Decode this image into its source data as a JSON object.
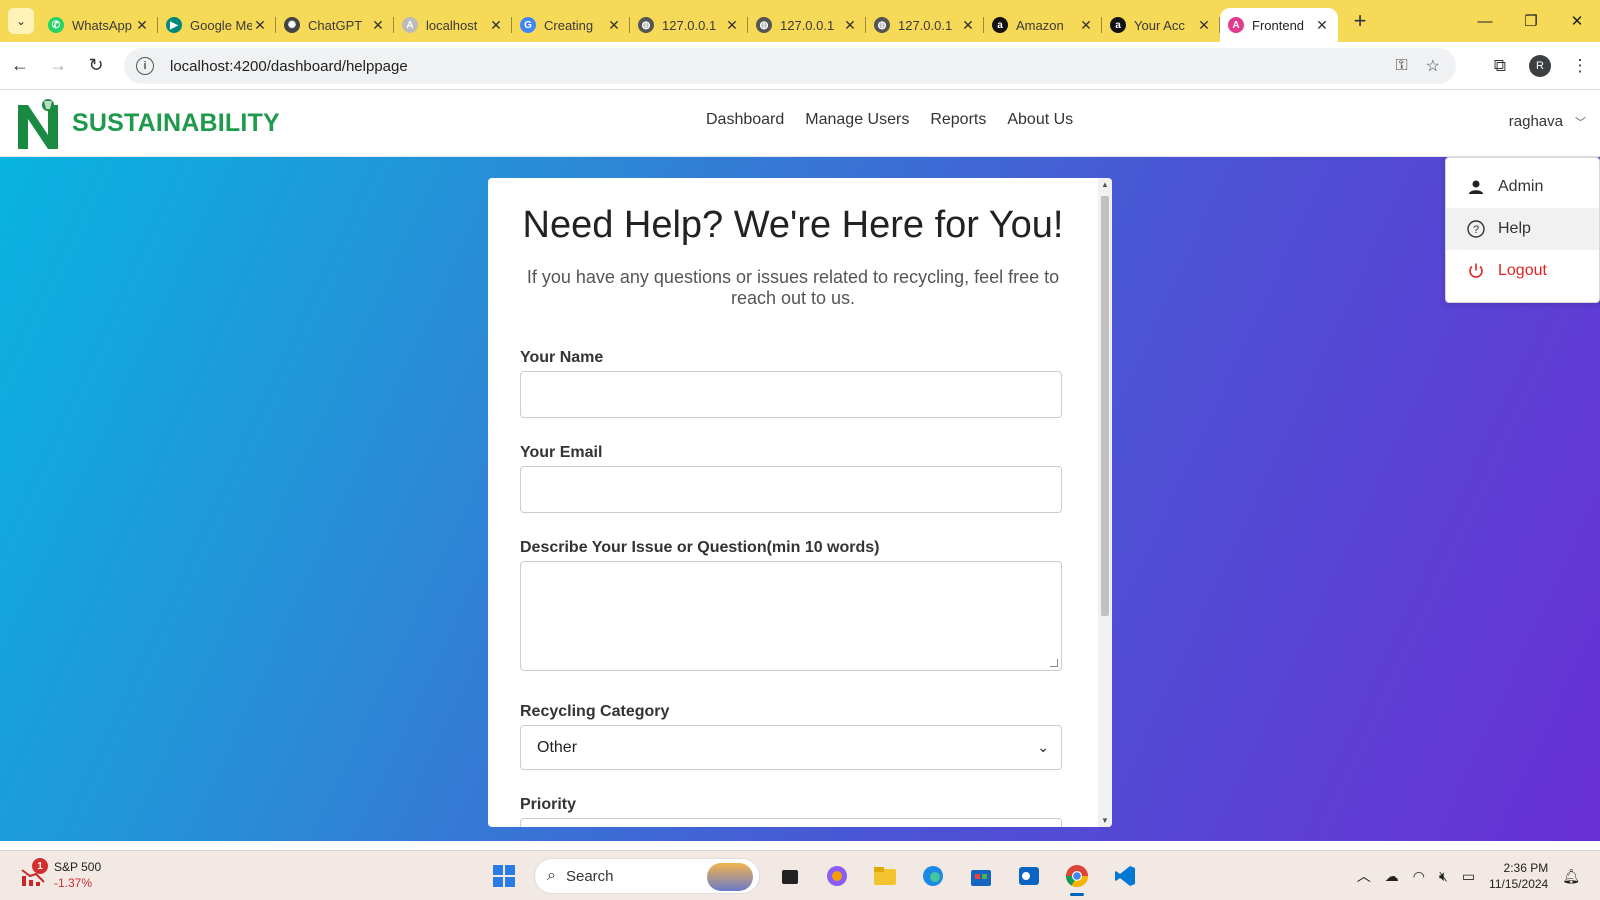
{
  "browser": {
    "tabs": [
      {
        "title": "WhatsApp",
        "icon": "whatsapp-icon",
        "color": "#25d366",
        "glyph": "✆"
      },
      {
        "title": "Google Meet",
        "icon": "google-meet-icon",
        "color": "#00897b",
        "glyph": "▶"
      },
      {
        "title": "ChatGPT",
        "icon": "chatgpt-icon",
        "color": "#444444",
        "glyph": "✺"
      },
      {
        "title": "localhost",
        "icon": "angular-icon",
        "color": "#bbbbbb",
        "glyph": "A"
      },
      {
        "title": "Creating",
        "icon": "google-icon",
        "color": "#4285f4",
        "glyph": "G"
      },
      {
        "title": "127.0.0.1",
        "icon": "globe-icon",
        "color": "#555555",
        "glyph": "◍"
      },
      {
        "title": "127.0.0.1",
        "icon": "globe-icon",
        "color": "#555555",
        "glyph": "◍"
      },
      {
        "title": "127.0.0.1",
        "icon": "globe-icon",
        "color": "#555555",
        "glyph": "◍"
      },
      {
        "title": "Amazon",
        "icon": "amazon-icon",
        "color": "#111111",
        "glyph": "a"
      },
      {
        "title": "Your Acc",
        "icon": "amazon-icon",
        "color": "#111111",
        "glyph": "a"
      },
      {
        "title": "Frontend",
        "icon": "angular-icon",
        "color": "#e23a8a",
        "glyph": "A",
        "active": true
      }
    ],
    "url": "localhost:4200/dashboard/helppage"
  },
  "app": {
    "brand": "SUSTAINABILITY",
    "nav": [
      "Dashboard",
      "Manage Users",
      "Reports",
      "About Us"
    ],
    "user": "raghava",
    "menu": {
      "admin": "Admin",
      "help": "Help",
      "logout": "Logout"
    }
  },
  "help": {
    "title": "Need Help? We're Here for You!",
    "subtitle": "If you have any questions or issues related to recycling, feel free to reach out to us.",
    "name_label": "Your Name",
    "email_label": "Your Email",
    "issue_label": "Describe Your Issue or Question(min 10 words)",
    "category_label": "Recycling Category",
    "category_value": "Other",
    "priority_label": "Priority"
  },
  "taskbar": {
    "stock_name": "S&P 500",
    "stock_change": "-1.37%",
    "stock_badge": "1",
    "search": "Search",
    "time": "2:36 PM",
    "date": "11/15/2024"
  },
  "colors": {
    "brand_green": "#1f9a4c",
    "logout_red": "#e02424",
    "tab_strip": "#f6d957"
  }
}
